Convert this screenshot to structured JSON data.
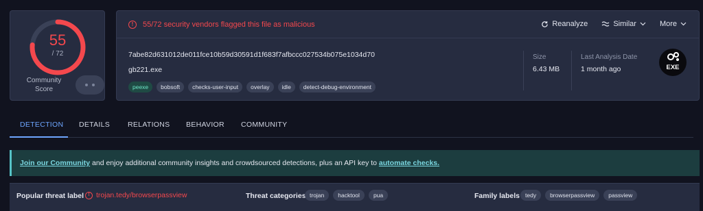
{
  "score": {
    "detected": "55",
    "total": "/ 72",
    "fraction": 0.764,
    "community_label": "Community Score",
    "color": "#f4484d"
  },
  "alert": {
    "text": "55/72 security vendors flagged this file as malicious",
    "icon": "alert-circle-icon"
  },
  "actions": {
    "reanalyze": "Reanalyze",
    "similar": "Similar",
    "more": "More"
  },
  "file": {
    "hash": "7abe82d631012de011fce10b59d30591d1f683f7afbccc027534b075e1034d70",
    "name": "gb221.exe",
    "tags": [
      "peexe",
      "bobsoft",
      "checks-user-input",
      "overlay",
      "idle",
      "detect-debug-environment"
    ],
    "size_label": "Size",
    "size_value": "6.43 MB",
    "last_analysis_label": "Last Analysis Date",
    "last_analysis_value": "1 month ago",
    "type_badge": "EXE"
  },
  "tabs": [
    "DETECTION",
    "DETAILS",
    "RELATIONS",
    "BEHAVIOR",
    "COMMUNITY"
  ],
  "banner": {
    "link1": "Join our Community",
    "middle": " and enjoy additional community insights and crowdsourced detections, plus an API key to ",
    "link2": "automate checks."
  },
  "threat": {
    "popular_label": "Popular threat label",
    "popular_value": "trojan.tedy/browserpassview",
    "categories_label": "Threat categories",
    "categories": [
      "trojan",
      "hacktool",
      "pua"
    ],
    "family_label": "Family labels",
    "families": [
      "tedy",
      "browserpassview",
      "passview"
    ]
  },
  "colors": {
    "accent": "#6ea6ff",
    "danger": "#f4484d",
    "background": "#11131f",
    "card": "#262c40"
  }
}
